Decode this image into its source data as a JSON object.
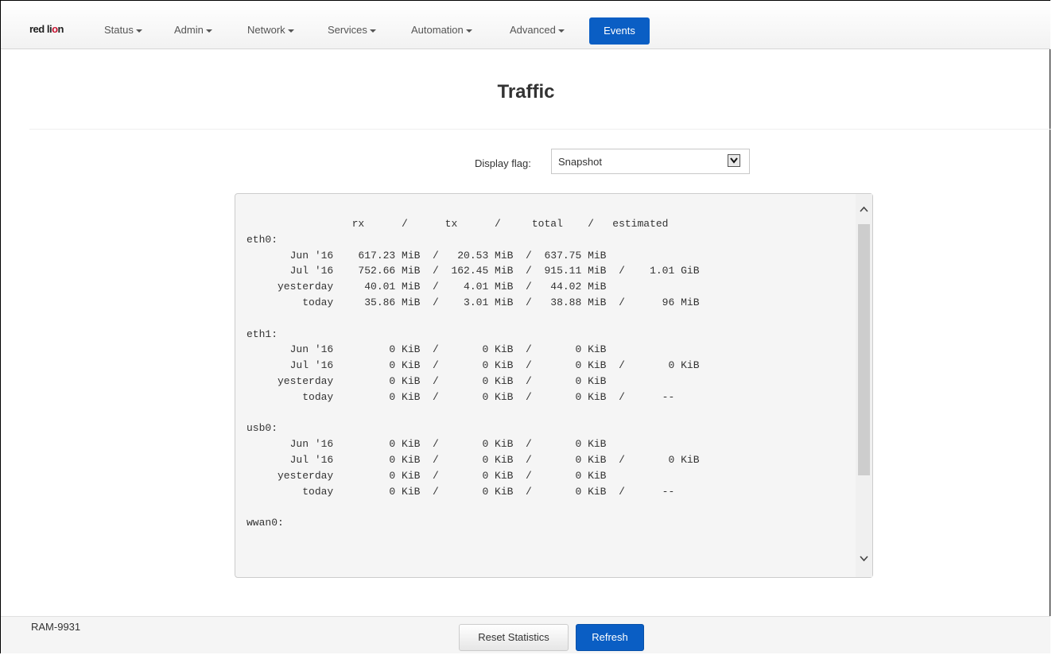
{
  "nav": {
    "logo": {
      "prefix": "red li",
      "accent": "o",
      "suffix": "n"
    },
    "items": [
      {
        "label": "Status"
      },
      {
        "label": "Admin"
      },
      {
        "label": "Network"
      },
      {
        "label": "Services"
      },
      {
        "label": "Automation"
      },
      {
        "label": "Advanced"
      }
    ],
    "active": {
      "label": "Events"
    }
  },
  "page": {
    "title": "Traffic"
  },
  "display_flag": {
    "label": "Display flag:",
    "selected": "Snapshot"
  },
  "traffic_text": "                 rx      /      tx      /     total    /   estimated\neth0:\n       Jun '16    617.23 MiB  /   20.53 MiB  /  637.75 MiB\n       Jul '16    752.66 MiB  /  162.45 MiB  /  915.11 MiB  /    1.01 GiB\n     yesterday     40.01 MiB  /    4.01 MiB  /   44.02 MiB\n         today     35.86 MiB  /    3.01 MiB  /   38.88 MiB  /      96 MiB\n\neth1:\n       Jun '16         0 KiB  /       0 KiB  /       0 KiB\n       Jul '16         0 KiB  /       0 KiB  /       0 KiB  /       0 KiB\n     yesterday         0 KiB  /       0 KiB  /       0 KiB\n         today         0 KiB  /       0 KiB  /       0 KiB  /      --\n\nusb0:\n       Jun '16         0 KiB  /       0 KiB  /       0 KiB\n       Jul '16         0 KiB  /       0 KiB  /       0 KiB  /       0 KiB\n     yesterday         0 KiB  /       0 KiB  /       0 KiB\n         today         0 KiB  /       0 KiB  /       0 KiB  /      --\n\nwwan0:",
  "footer": {
    "device": "RAM-9931",
    "reset_label": "Reset Statistics",
    "refresh_label": "Refresh"
  },
  "colors": {
    "accent": "#0a5ec4",
    "logo_accent": "#c8102e"
  },
  "icons": [
    "chevron-down-icon",
    "scroll-up-icon",
    "scroll-down-icon",
    "caret-down-icon"
  ]
}
